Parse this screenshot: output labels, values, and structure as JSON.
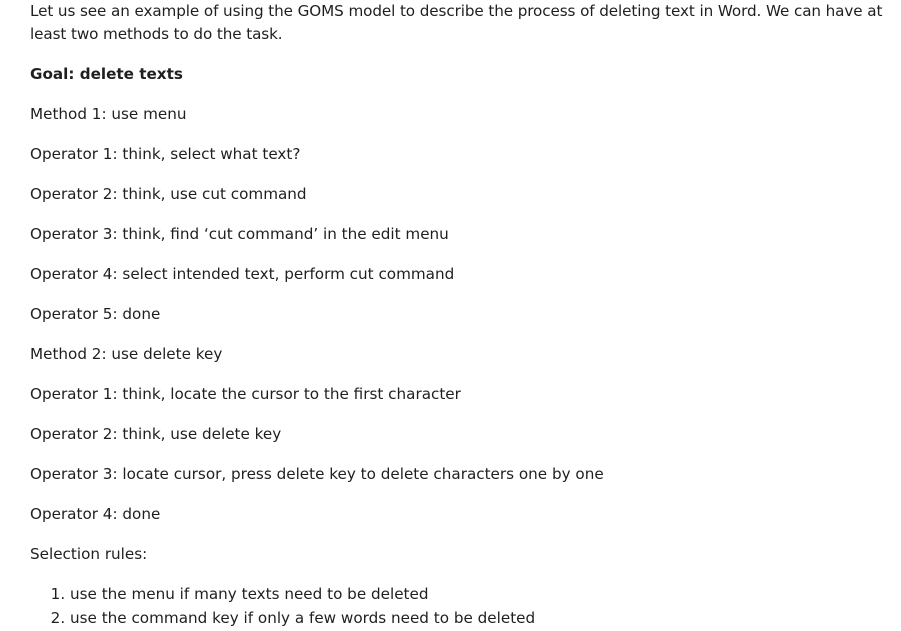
{
  "document": {
    "intro": "Let us see an example of using the GOMS model to describe the process of deleting text in Word. We can have at least two methods to do the task.",
    "goal": "Goal: delete texts",
    "method1": {
      "title": "Method 1: use menu",
      "operators": [
        "Operator 1: think, select what text?",
        "Operator 2: think, use cut command",
        "Operator 3: think, find ‘cut command’ in the edit menu",
        "Operator 4: select intended text, perform cut command",
        "Operator 5: done"
      ]
    },
    "method2": {
      "title": "Method 2: use delete key",
      "operators": [
        "Operator 1: think, locate the cursor to the first character",
        "Operator 2: think, use delete key",
        "Operator 3: locate cursor, press delete key to delete characters one by one",
        "Operator 4: done"
      ]
    },
    "selection_rules": {
      "title": "Selection rules:",
      "items": [
        "use the menu if many texts need to be deleted",
        "use the command key if only a few words need to be deleted"
      ]
    }
  }
}
